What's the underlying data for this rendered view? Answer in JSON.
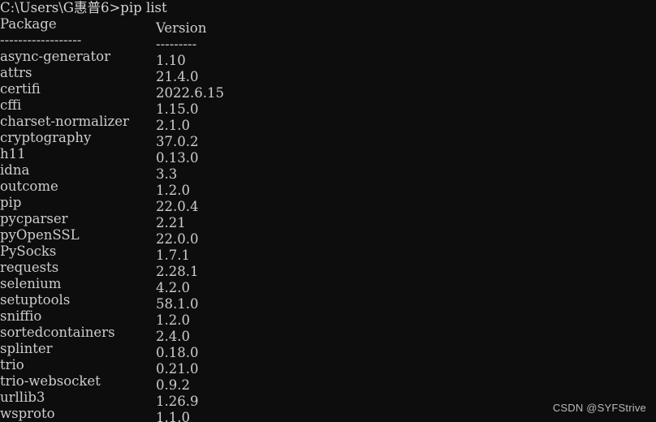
{
  "window": {
    "title": "Command Prompt",
    "background_color": "#0d0d0d",
    "text_color": "#cdcdcd"
  },
  "terminal": {
    "prompt_line": "C:\\Users\\G惠普6>pip list",
    "header": {
      "package_label": "Package",
      "version_label": "Version"
    },
    "separator": {
      "package_rule": "------------------",
      "version_rule": "---------"
    },
    "rows": [
      {
        "package": "async-generator",
        "version": "1.10"
      },
      {
        "package": "attrs",
        "version": "21.4.0"
      },
      {
        "package": "certifi",
        "version": "2022.6.15"
      },
      {
        "package": "cffi",
        "version": "1.15.0"
      },
      {
        "package": "charset-normalizer",
        "version": "2.1.0"
      },
      {
        "package": "cryptography",
        "version": "37.0.2"
      },
      {
        "package": "h11",
        "version": "0.13.0"
      },
      {
        "package": "idna",
        "version": "3.3"
      },
      {
        "package": "outcome",
        "version": "1.2.0"
      },
      {
        "package": "pip",
        "version": "22.0.4"
      },
      {
        "package": "pycparser",
        "version": "2.21"
      },
      {
        "package": "pyOpenSSL",
        "version": "22.0.0"
      },
      {
        "package": "PySocks",
        "version": "1.7.1"
      },
      {
        "package": "requests",
        "version": "2.28.1"
      },
      {
        "package": "selenium",
        "version": "4.2.0"
      },
      {
        "package": "setuptools",
        "version": "58.1.0"
      },
      {
        "package": "sniffio",
        "version": "1.2.0"
      },
      {
        "package": "sortedcontainers",
        "version": "2.4.0"
      },
      {
        "package": "splinter",
        "version": "0.18.0"
      },
      {
        "package": "trio",
        "version": "0.21.0"
      },
      {
        "package": "trio-websocket",
        "version": "0.9.2"
      },
      {
        "package": "urllib3",
        "version": "1.26.9"
      },
      {
        "package": "wsproto",
        "version": "1.1.0"
      }
    ]
  },
  "watermark": {
    "text": "CSDN @SYFStrive"
  }
}
